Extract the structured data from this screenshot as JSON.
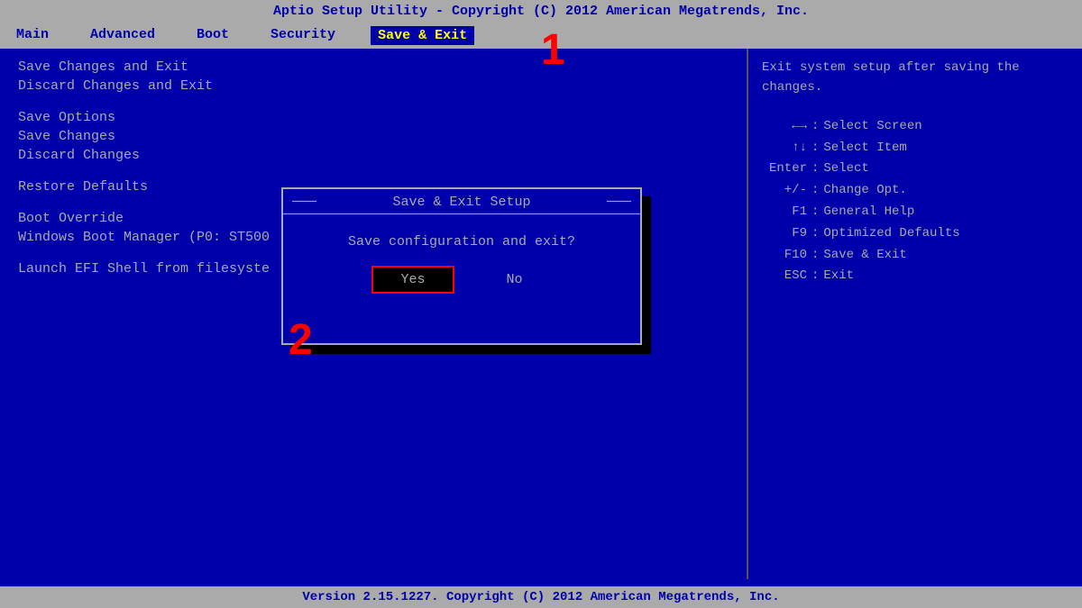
{
  "title_bar": {
    "text": "Aptio Setup Utility - Copyright (C) 2012 American Megatrends, Inc."
  },
  "menu_bar": {
    "items": [
      {
        "id": "main",
        "label": "Main",
        "active": false
      },
      {
        "id": "advanced",
        "label": "Advanced",
        "active": false
      },
      {
        "id": "boot",
        "label": "Boot",
        "active": false
      },
      {
        "id": "security",
        "label": "Security",
        "active": false
      },
      {
        "id": "save_exit",
        "label": "Save & Exit",
        "active": true
      }
    ]
  },
  "left_panel": {
    "options": [
      {
        "id": "save_changes_exit",
        "label": "Save Changes and Exit"
      },
      {
        "id": "discard_changes_exit",
        "label": "Discard Changes and Exit"
      },
      {
        "id": "save_options_header",
        "label": "Save Options"
      },
      {
        "id": "save_changes",
        "label": "Save Changes"
      },
      {
        "id": "discard_changes",
        "label": "Discard Changes"
      },
      {
        "id": "restore_defaults",
        "label": "Restore Defaults"
      },
      {
        "id": "boot_override_header",
        "label": "Boot Override"
      },
      {
        "id": "windows_boot",
        "label": "Windows Boot Manager (P0: ST500"
      },
      {
        "id": "launch_efi",
        "label": "Launch EFI Shell from filesyste"
      }
    ]
  },
  "right_panel": {
    "help_text": "Exit system setup after saving the changes.",
    "key_hints": [
      {
        "key": "←→",
        "sep": ":",
        "desc": "Select Screen"
      },
      {
        "key": "↑↓",
        "sep": ":",
        "desc": "Select Item"
      },
      {
        "key": "Enter",
        "sep": ":",
        "desc": "Select"
      },
      {
        "key": "+/-",
        "sep": ":",
        "desc": "Change Opt."
      },
      {
        "key": "F1",
        "sep": ":",
        "desc": "General Help"
      },
      {
        "key": "F9",
        "sep": ":",
        "desc": "Optimized Defaults"
      },
      {
        "key": "F10",
        "sep": ":",
        "desc": "Save & Exit"
      },
      {
        "key": "ESC",
        "sep": ":",
        "desc": "Exit"
      }
    ]
  },
  "dialog": {
    "title": "Save & Exit Setup",
    "message": "Save configuration and exit?",
    "buttons": [
      {
        "id": "yes",
        "label": "Yes",
        "selected": true
      },
      {
        "id": "no",
        "label": "No",
        "selected": false
      }
    ]
  },
  "bottom_bar": {
    "text": "Version 2.15.1227. Copyright (C) 2012 American Megatrends, Inc."
  },
  "annotations": {
    "one": "1",
    "two": "2"
  }
}
